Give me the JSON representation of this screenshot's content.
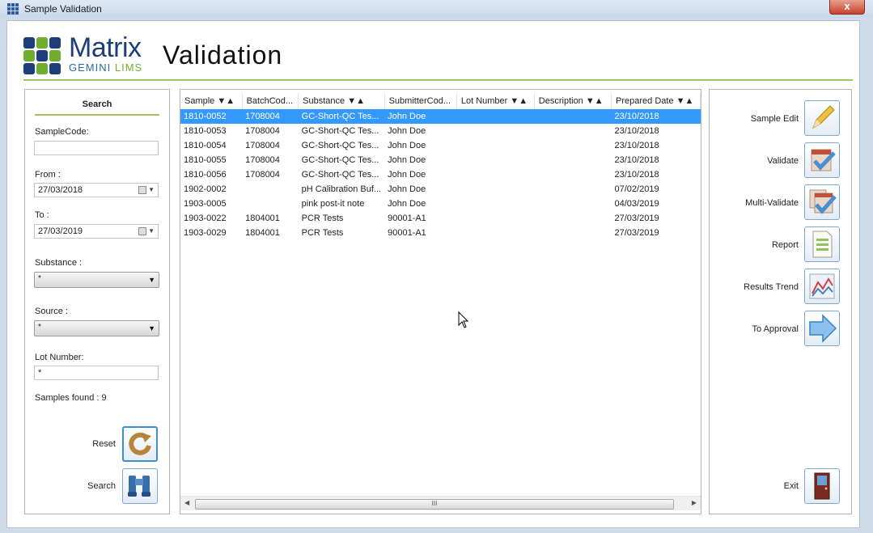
{
  "window": {
    "title": "Sample Validation",
    "close_label": "x"
  },
  "header": {
    "brand_name": "Matrix",
    "brand_sub": "GEMINI",
    "brand_lims": "LIMS",
    "page_title": "Validation"
  },
  "search_panel": {
    "header": "Search",
    "sample_code_label": "SampleCode:",
    "sample_code_value": "",
    "from_label": "From :",
    "from_value": "27/03/2018",
    "to_label": "To :",
    "to_value": "27/03/2019",
    "substance_label": "Substance :",
    "substance_value": "*",
    "source_label": "Source :",
    "source_value": "*",
    "lot_label": "Lot Number:",
    "lot_value": "*",
    "samples_found": "Samples found : 9",
    "reset_label": "Reset",
    "search_label": "Search"
  },
  "grid": {
    "columns": [
      "Sample ▼▲",
      "BatchCod...",
      "Substance ▼▲",
      "SubmitterCod...",
      "Lot Number ▼▲",
      "Description ▼▲",
      "Prepared Date ▼▲"
    ],
    "rows": [
      [
        "1810-0052",
        "1708004",
        "GC-Short-QC Tes...",
        "John Doe",
        "",
        "",
        "23/10/2018"
      ],
      [
        "1810-0053",
        "1708004",
        "GC-Short-QC Tes...",
        "John Doe",
        "",
        "",
        "23/10/2018"
      ],
      [
        "1810-0054",
        "1708004",
        "GC-Short-QC Tes...",
        "John Doe",
        "",
        "",
        "23/10/2018"
      ],
      [
        "1810-0055",
        "1708004",
        "GC-Short-QC Tes...",
        "John Doe",
        "",
        "",
        "23/10/2018"
      ],
      [
        "1810-0056",
        "1708004",
        "GC-Short-QC Tes...",
        "John Doe",
        "",
        "",
        "23/10/2018"
      ],
      [
        "1902-0002",
        "",
        "pH Calibration Buf...",
        "John Doe",
        "",
        "",
        "07/02/2019"
      ],
      [
        "1903-0005",
        "",
        "pink post-it note",
        "John Doe",
        "",
        "",
        "04/03/2019"
      ],
      [
        "1903-0022",
        "1804001",
        "PCR Tests",
        "90001-A1",
        "",
        "",
        "27/03/2019"
      ],
      [
        "1903-0029",
        "1804001",
        "PCR Tests",
        "90001-A1",
        "",
        "",
        "27/03/2019"
      ]
    ],
    "selected_row": 0,
    "scroll_thumb": "III"
  },
  "actions": {
    "sample_edit": "Sample Edit",
    "validate": "Validate",
    "multi_validate": "Multi-Validate",
    "report": "Report",
    "results_trend": "Results Trend",
    "to_approval": "To Approval",
    "exit": "Exit"
  },
  "colors": {
    "accent_green": "#9fc45b",
    "selection_blue": "#3399ff",
    "brand_navy": "#1e3e7a"
  },
  "icons": [
    "app-grid-icon",
    "close-icon",
    "calendar-icon",
    "dropdown-arrow-icon",
    "reset-arrow-icon",
    "binoculars-icon",
    "pencil-icon",
    "validate-check-icon",
    "multi-validate-icon",
    "report-document-icon",
    "trend-chart-icon",
    "arrow-right-icon",
    "exit-door-icon"
  ]
}
